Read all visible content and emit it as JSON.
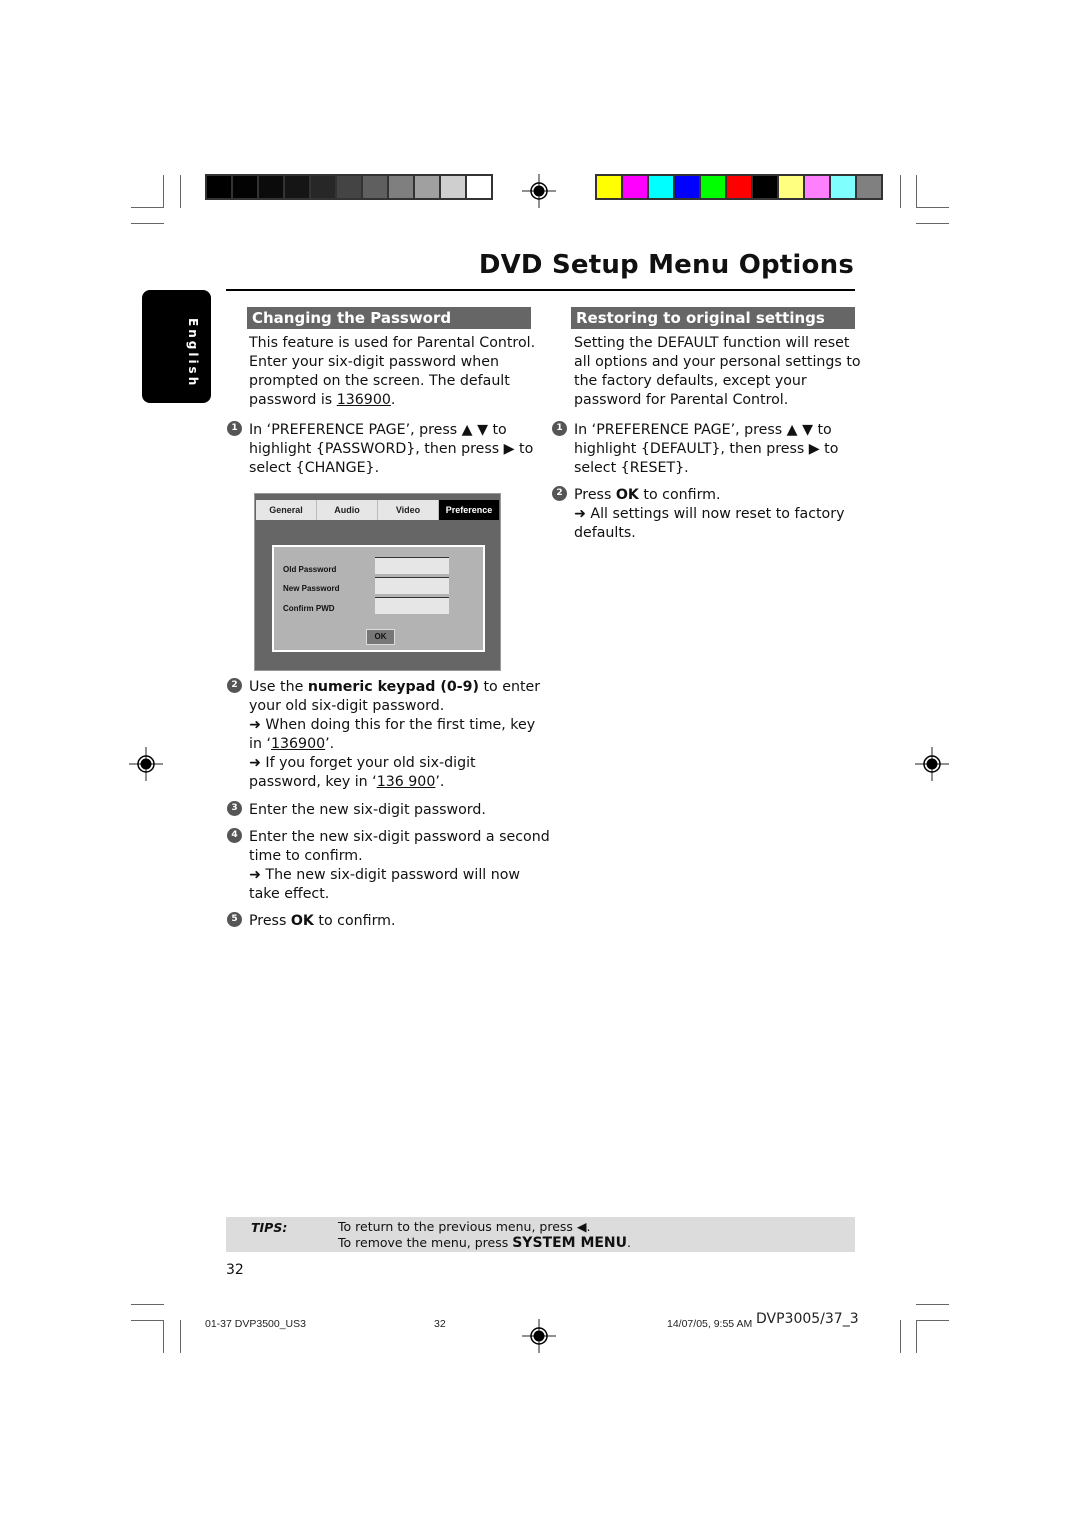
{
  "page": {
    "title": "DVD Setup Menu Options",
    "language_tab": "English",
    "page_number": "32"
  },
  "print_marks": {
    "grayscale_bar": [
      "#000000",
      "#030303",
      "#0b0b0b",
      "#151515",
      "#272727",
      "#444444",
      "#5f5f5f",
      "#7f7f7f",
      "#a0a0a0",
      "#cfcfcf",
      "#ffffff"
    ],
    "color_bar": [
      "#ffff00",
      "#ff00ff",
      "#00ffff",
      "#0000ff",
      "#00ff00",
      "#ff0000",
      "#000000",
      "#ffff80",
      "#ff80ff",
      "#80ffff",
      "#808080"
    ]
  },
  "left_section": {
    "header": "Changing the Password",
    "intro": {
      "line1": "This feature is used for Parental Control.",
      "line2": "Enter your six-digit password when",
      "line3": "prompted on the screen. The default",
      "line4_prefix": "password is ",
      "line4_value": "136900",
      "line4_suffix": "."
    },
    "step1": {
      "num": "1",
      "line1": "In ‘PREFERENCE PAGE’, press ▲ ▼ to",
      "line2": "highlight {PASSWORD}, then press ▶ to",
      "line3": "select {CHANGE}."
    },
    "menu_screen": {
      "tabs": [
        "General",
        "Audio",
        "Video",
        "Preference"
      ],
      "active_tab": "Preference",
      "fields": [
        "Old Password",
        "New Password",
        "Confirm PWD"
      ],
      "ok_label": "OK"
    },
    "step2": {
      "num": "2",
      "prefix": "Use the ",
      "bold": "numeric keypad (0-9)",
      "suffix": " to enter",
      "line2": "your old six-digit password.",
      "note1_a": "➜ When doing this for the first time, key",
      "note1_b_prefix": "in ‘",
      "note1_b_value": "136900",
      "note1_b_suffix": "’.",
      "note2_a": "➜ If you forget your old six-digit",
      "note2_b_prefix": "password, key in ‘",
      "note2_b_value": "136 900",
      "note2_b_suffix": "’."
    },
    "step3": {
      "num": "3",
      "text": "Enter the new six-digit password."
    },
    "step4": {
      "num": "4",
      "line1": "Enter the new six-digit password a second",
      "line2": "time to confirm.",
      "note_a": "➜ The new six-digit password will now",
      "note_b": "take effect."
    },
    "step5": {
      "num": "5",
      "prefix": "Press ",
      "bold": "OK",
      "suffix": " to confirm."
    }
  },
  "right_section": {
    "header": "Restoring to original settings",
    "intro": {
      "line1": "Setting the DEFAULT function will reset",
      "line2": "all options and your personal settings to",
      "line3": "the factory defaults, except your",
      "line4": "password for Parental Control."
    },
    "step1": {
      "num": "1",
      "line1": "In ‘PREFERENCE PAGE’, press ▲ ▼ to",
      "line2": "highlight {DEFAULT}, then press ▶  to",
      "line3": "select {RESET}."
    },
    "step2": {
      "num": "2",
      "prefix": "Press ",
      "bold": "OK",
      "suffix": " to confirm.",
      "note_a": "➜ All settings will now reset to factory",
      "note_b": "defaults."
    }
  },
  "tips": {
    "label": "TIPS:",
    "line1": "To return to the previous menu, press ◀.",
    "line2_prefix": "To remove the menu, press ",
    "line2_bold": "SYSTEM MENU",
    "line2_suffix": "."
  },
  "footer": {
    "file": "01-37 DVP3500_US3",
    "page": "32",
    "datetime": "14/07/05, 9:55 AM",
    "model": "DVP3005/37_3"
  }
}
